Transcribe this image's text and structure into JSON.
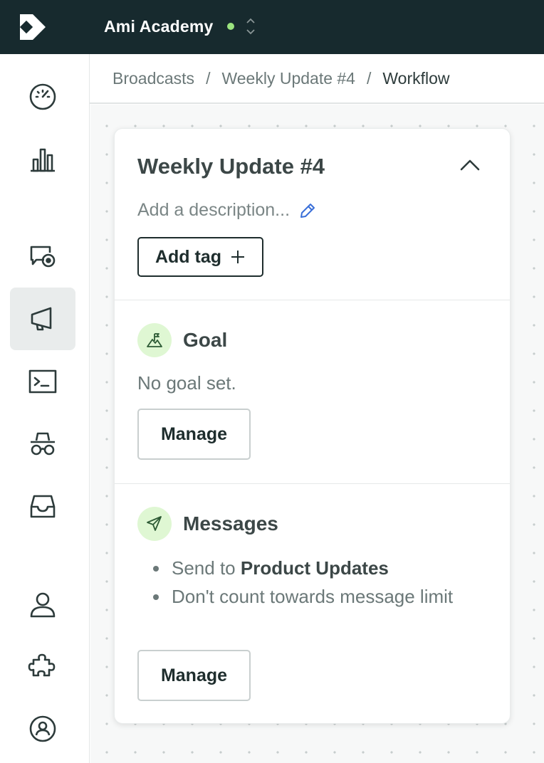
{
  "workspace": {
    "name": "Ami Academy",
    "status_color": "#9be37f"
  },
  "breadcrumb": {
    "items": [
      "Broadcasts",
      "Weekly Update #4",
      "Workflow"
    ],
    "separator": "/"
  },
  "sidebar": {
    "items": [
      {
        "name": "dashboard",
        "icon": "speedometer-icon"
      },
      {
        "name": "reports",
        "icon": "bar-chart-icon"
      },
      {
        "name": "conversations",
        "icon": "chat-target-icon"
      },
      {
        "name": "broadcasts",
        "icon": "megaphone-icon",
        "active": true
      },
      {
        "name": "console",
        "icon": "terminal-icon"
      },
      {
        "name": "incognito",
        "icon": "spy-icon"
      },
      {
        "name": "inbox",
        "icon": "inbox-icon"
      },
      {
        "name": "contacts",
        "icon": "user-icon"
      },
      {
        "name": "integrations",
        "icon": "puzzle-icon"
      },
      {
        "name": "account",
        "icon": "user-circle-icon"
      }
    ]
  },
  "workflow": {
    "title": "Weekly Update #4",
    "description_placeholder": "Add a description...",
    "add_tag_label": "Add tag",
    "goal": {
      "title": "Goal",
      "text": "No goal set.",
      "button": "Manage"
    },
    "messages": {
      "title": "Messages",
      "bullet1_prefix": "Send to ",
      "bullet1_bold": "Product Updates",
      "bullet2": "Don't count towards message limit",
      "button": "Manage"
    }
  },
  "colors": {
    "topbar": "#172a2e",
    "accent_green": "#dff7d3",
    "edit_blue": "#3a6fd8"
  }
}
